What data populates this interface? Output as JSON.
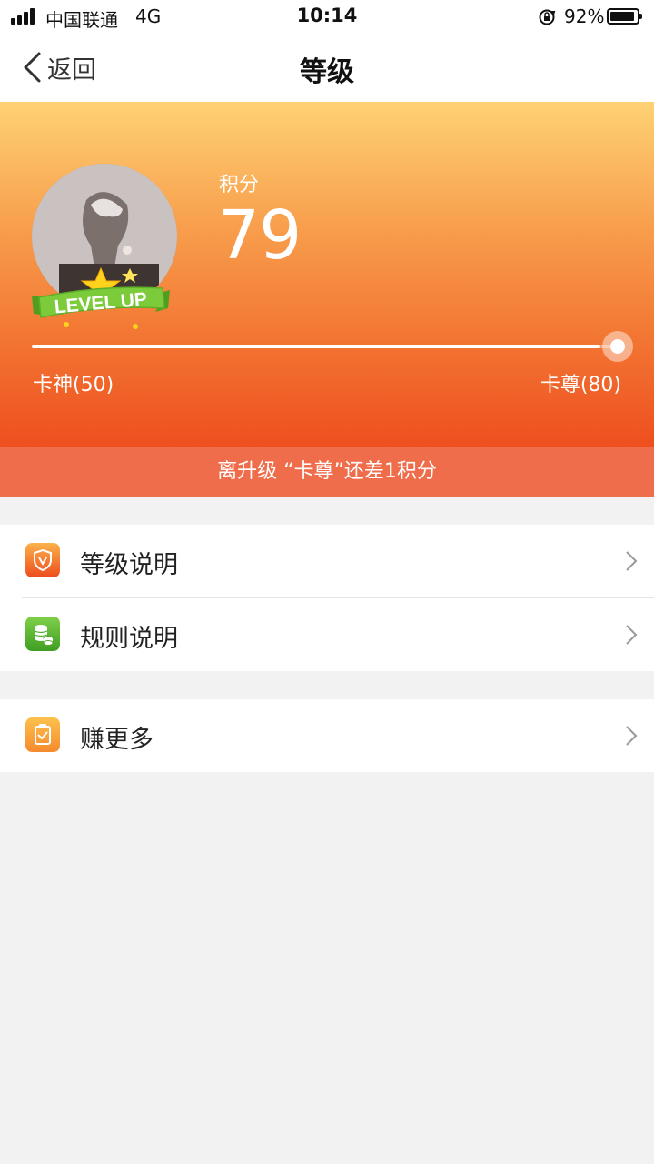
{
  "status_bar": {
    "carrier": "中国联通",
    "network": "4G",
    "time": "10:14",
    "battery_percent": "92%",
    "battery_level": 0.92
  },
  "nav": {
    "back_label": "返回",
    "title": "等级"
  },
  "header": {
    "badge_text": "LEVEL UP",
    "score_label": "积分",
    "score_value": "79",
    "progress": 0.97,
    "level_min_label": "卡神(50)",
    "level_max_label": "卡尊(80)",
    "upgrade_hint": "离升级 “卡尊”还差1积分"
  },
  "menu": {
    "group1": [
      {
        "label": "等级说明",
        "icon": "shield-v-icon"
      },
      {
        "label": "规则说明",
        "icon": "coins-icon"
      }
    ],
    "group2": [
      {
        "label": "赚更多",
        "icon": "clipboard-check-icon"
      }
    ]
  },
  "colors": {
    "accent_orange": "#ee4f1f",
    "banner": "#ef6d4b",
    "green": "#5bbf35",
    "yellow_orange": "#f7a33a"
  }
}
